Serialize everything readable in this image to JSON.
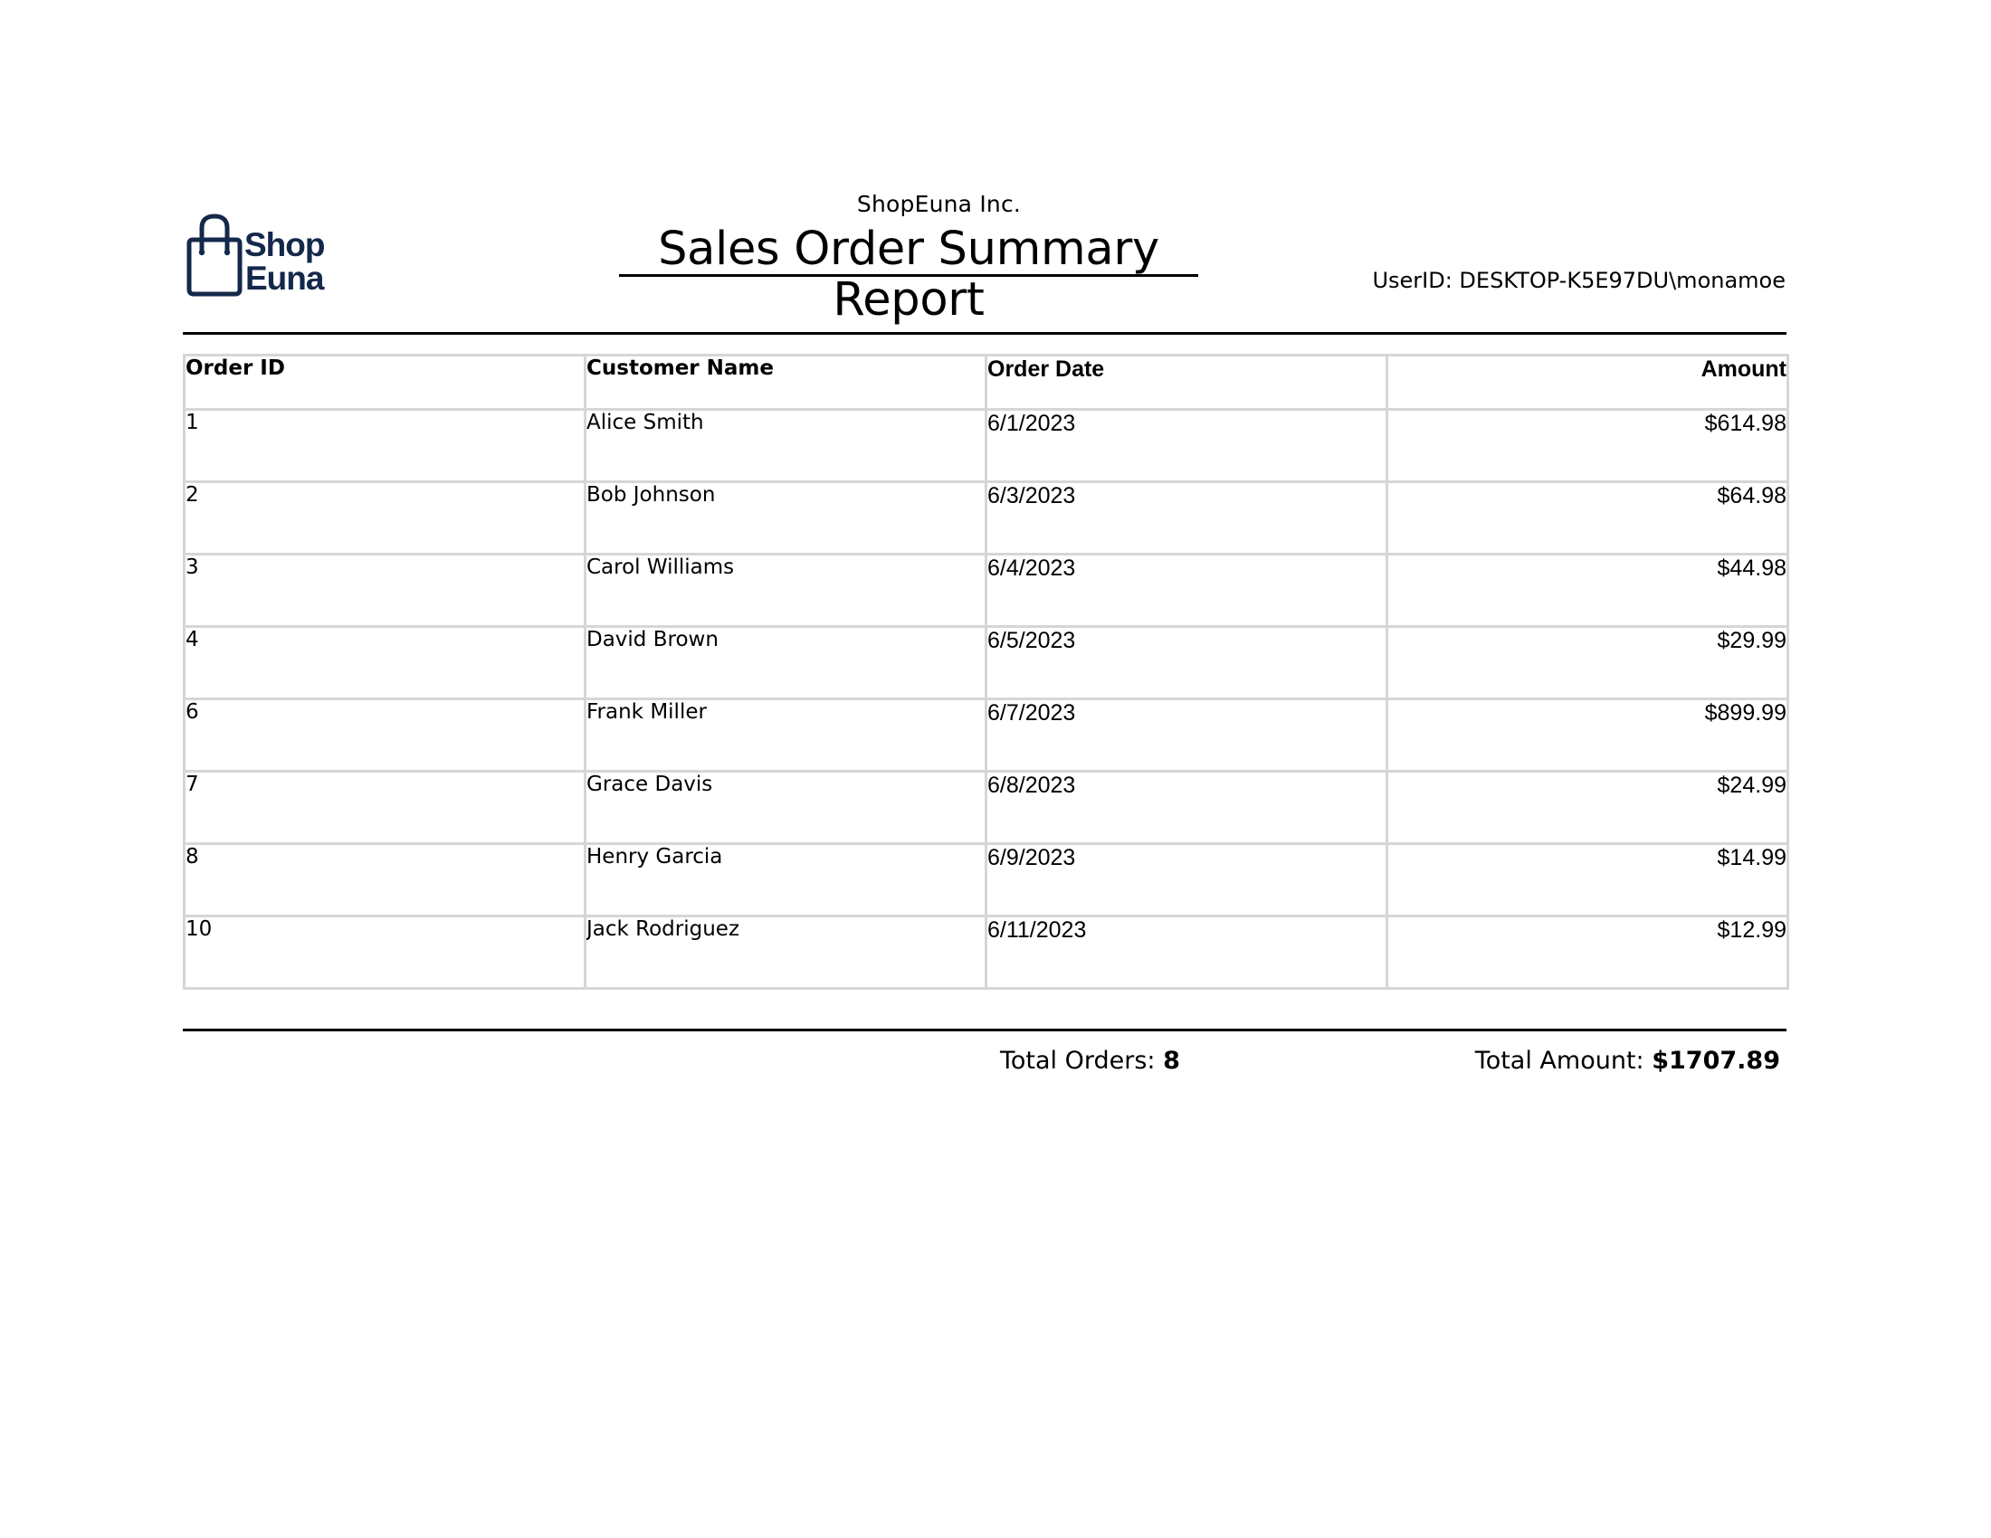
{
  "header": {
    "logo": {
      "text_line1": "Shop",
      "text_line2": "Euna",
      "icon": "shopping-bag-icon",
      "color": "#14284b"
    },
    "company_name": "ShopEuna Inc.",
    "report_title": "Sales Order Summary Report",
    "user_id": "UserID: DESKTOP-K5E97DU\\monamoe"
  },
  "table": {
    "columns": [
      "Order ID",
      "Customer Name",
      "Order Date",
      "Amount"
    ],
    "rows": [
      {
        "order_id": "1",
        "customer": "Alice Smith",
        "date": "6/1/2023",
        "amount": "$614.98"
      },
      {
        "order_id": "2",
        "customer": "Bob Johnson",
        "date": "6/3/2023",
        "amount": "$64.98"
      },
      {
        "order_id": "3",
        "customer": "Carol Williams",
        "date": "6/4/2023",
        "amount": "$44.98"
      },
      {
        "order_id": "4",
        "customer": "David Brown",
        "date": "6/5/2023",
        "amount": "$29.99"
      },
      {
        "order_id": "6",
        "customer": "Frank Miller",
        "date": "6/7/2023",
        "amount": "$899.99"
      },
      {
        "order_id": "7",
        "customer": "Grace Davis",
        "date": "6/8/2023",
        "amount": "$24.99"
      },
      {
        "order_id": "8",
        "customer": "Henry Garcia",
        "date": "6/9/2023",
        "amount": "$14.99"
      },
      {
        "order_id": "10",
        "customer": "Jack Rodriguez",
        "date": "6/11/2023",
        "amount": "$12.99"
      }
    ],
    "border_color": "#d6d6d6"
  },
  "totals": {
    "orders_label": "Total Orders:",
    "orders_value": "8",
    "amount_label": "Total Amount:",
    "amount_value": "$1707.89"
  }
}
